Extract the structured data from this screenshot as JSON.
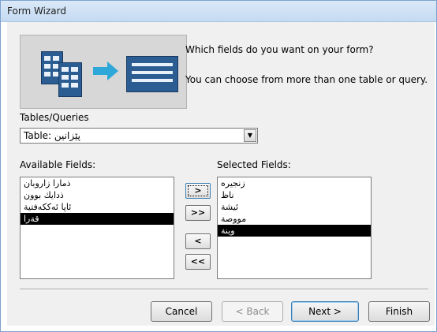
{
  "window": {
    "title": "Form Wizard"
  },
  "wizard": {
    "prompt": "Which fields do you want on your form?",
    "hint": "You can choose from more than one table or query."
  },
  "tables_queries": {
    "label": "Tables/Queries",
    "value": "Table: پێزانین"
  },
  "available_fields": {
    "label": "Available Fields:",
    "items": [
      {
        "text": "ذمارا زاروبان",
        "selected": false
      },
      {
        "text": "ذدایك بوون",
        "selected": false
      },
      {
        "text": "ئاپا ئەككەفتیة",
        "selected": false
      },
      {
        "text": "قةرا",
        "selected": true
      }
    ]
  },
  "selected_fields": {
    "label": "Selected Fields:",
    "items": [
      {
        "text": "زنجیرە",
        "selected": false
      },
      {
        "text": "ناظ",
        "selected": false
      },
      {
        "text": "ئیشة",
        "selected": false
      },
      {
        "text": "مووصة",
        "selected": false
      },
      {
        "text": "وینة",
        "selected": true
      }
    ]
  },
  "move_buttons": {
    "add_one": ">",
    "add_all": ">>",
    "remove_one": "<",
    "remove_all": "<<"
  },
  "footer": {
    "cancel": "Cancel",
    "back": "< Back",
    "next": "Next >",
    "finish": "Finish"
  },
  "colors": {
    "selection": "#000000",
    "title_bar": "#c4daf2",
    "dialog_bg": "#f0f0f0",
    "image_accent": "#2ea8d8"
  }
}
